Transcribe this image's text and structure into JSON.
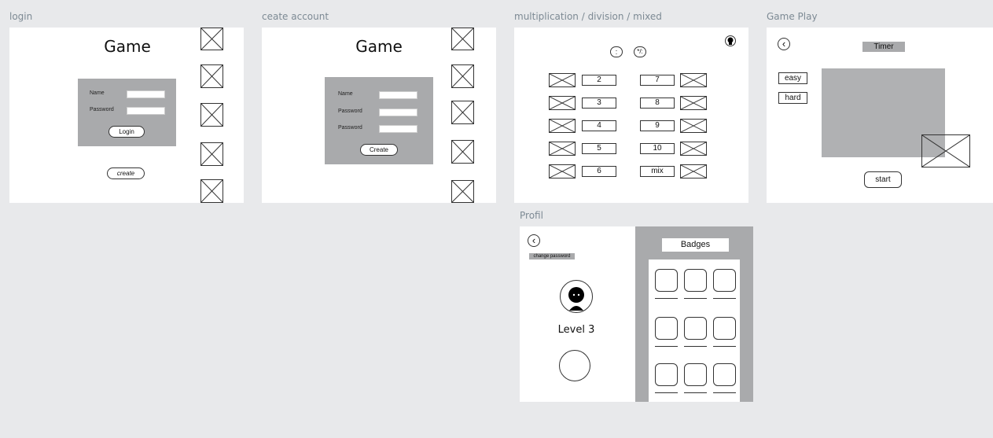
{
  "frames": {
    "login": "login",
    "create": "ceate account",
    "mult": "multiplication / division / mixed",
    "gameplay": "Game Play",
    "profil": "Profil"
  },
  "login": {
    "title": "Game",
    "name_label": "Name",
    "password_label": "Password",
    "login_button": "Login",
    "create_button": "create"
  },
  "create_account": {
    "title": "Game",
    "name_label": "Name",
    "password_label": "Password",
    "password2_label": "Password",
    "create_button": "Create"
  },
  "mult": {
    "op_div": ":",
    "op_mixed": "*/:",
    "left_numbers": [
      "2",
      "3",
      "4",
      "5",
      "6"
    ],
    "right_numbers": [
      "7",
      "8",
      "9",
      "10",
      "mix"
    ]
  },
  "gameplay": {
    "back": "‹",
    "timer": "Timer",
    "easy": "easy",
    "hard": "hard",
    "start": "start"
  },
  "profil": {
    "back": "‹",
    "change_password": "change password",
    "level": "Level 3",
    "badges_title": "Badges"
  }
}
